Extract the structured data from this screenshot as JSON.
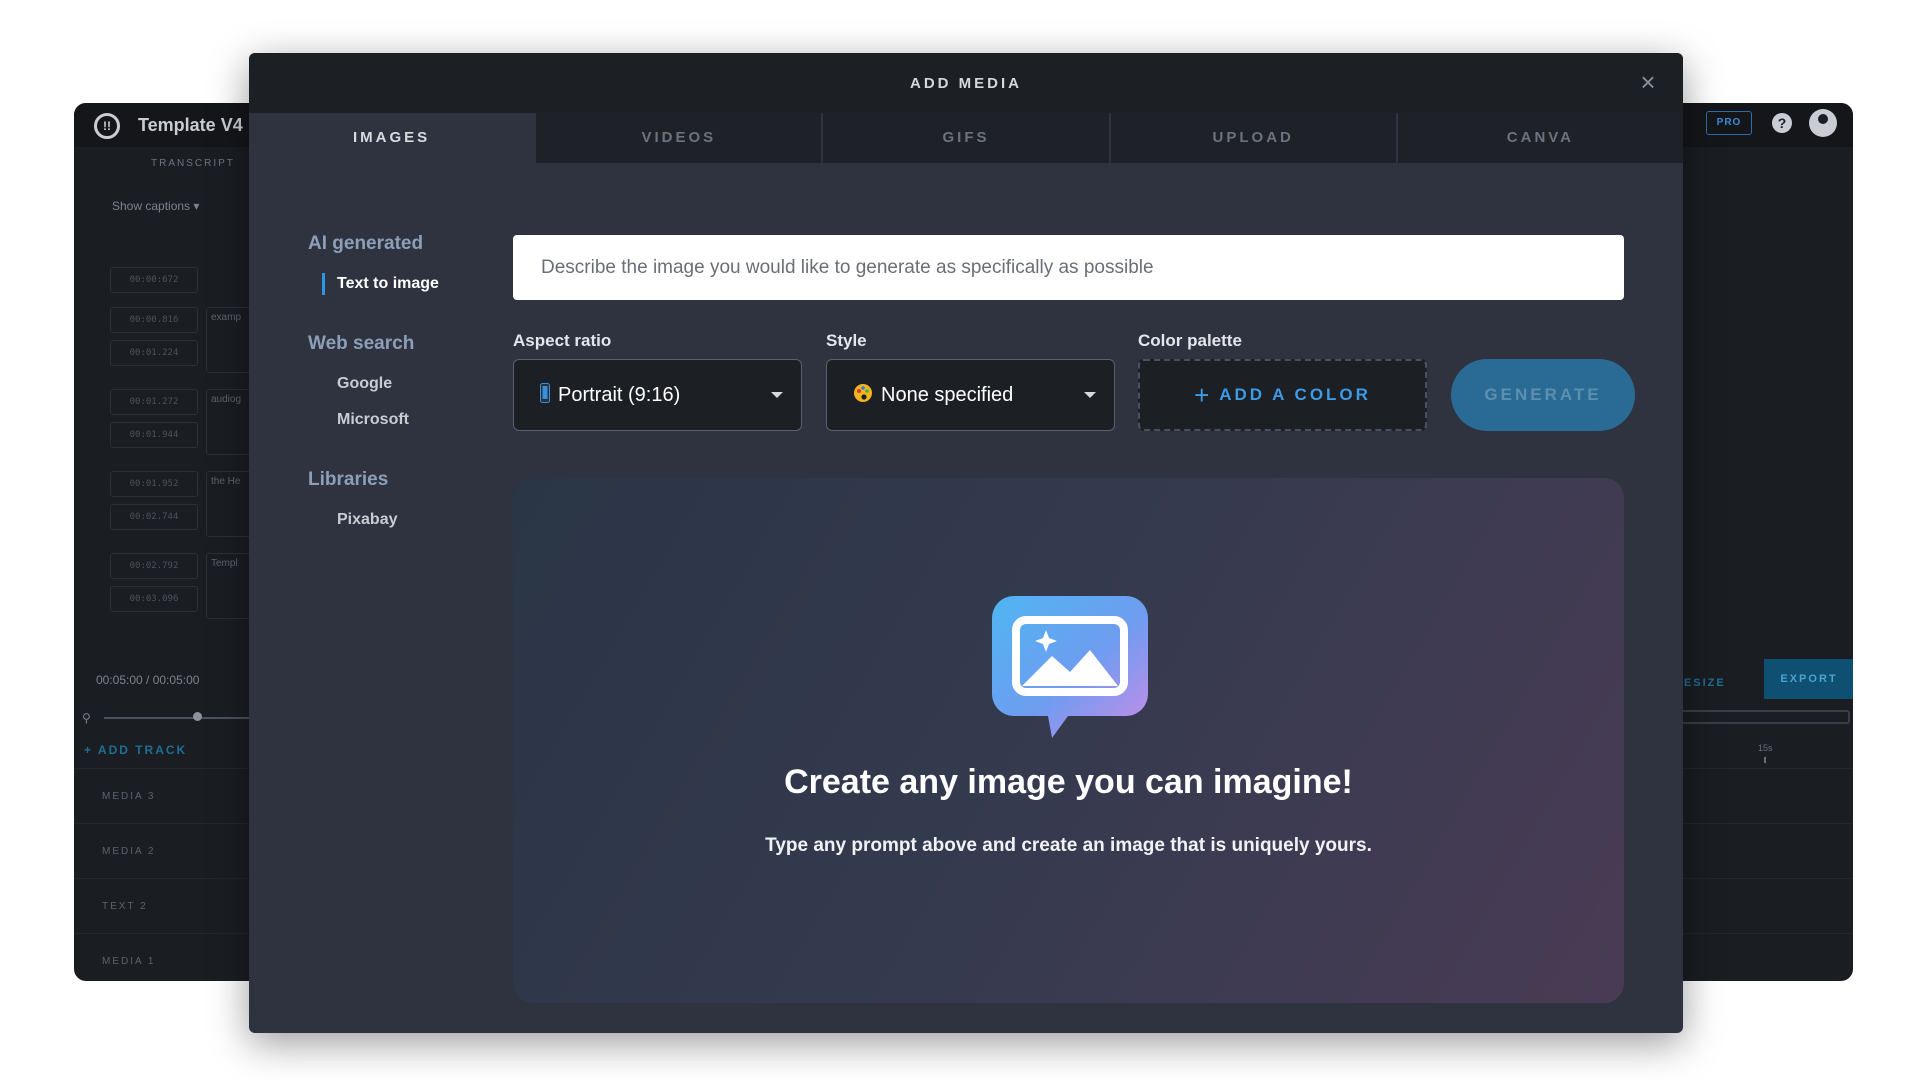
{
  "background_app": {
    "title": "Template V4",
    "panel_tab": "TRANSCRIPT",
    "captions_toggle": "Show captions  ▾",
    "caption_rows": [
      {
        "start": "00:00:672",
        "end": "",
        "text": ""
      },
      {
        "start": "00:00.816",
        "end": "00:01.224",
        "text": "examp"
      },
      {
        "start": "00:01.272",
        "end": "00:01.944",
        "text": "audiog"
      },
      {
        "start": "00:01.952",
        "end": "00:02.744",
        "text": "the He"
      },
      {
        "start": "00:02.792",
        "end": "00:03.096",
        "text": "Templ"
      }
    ],
    "time_display": "00:05:00 / 00:05:00",
    "add_track": "+ ADD TRACK",
    "tracks": [
      "MEDIA 3",
      "MEDIA 2",
      "TEXT 2",
      "MEDIA 1"
    ],
    "pro_badge": "PRO",
    "help_icon": "?",
    "resize_label": "RESIZE",
    "export_label": "EXPORT",
    "timeline_marker": "15s"
  },
  "modal": {
    "title": "ADD MEDIA",
    "close_icon": "×",
    "tabs": [
      {
        "label": "IMAGES",
        "active": true
      },
      {
        "label": "VIDEOS",
        "active": false
      },
      {
        "label": "GIFS",
        "active": false
      },
      {
        "label": "UPLOAD",
        "active": false
      },
      {
        "label": "CANVA",
        "active": false
      }
    ],
    "sidebar": {
      "ai_group": "AI generated",
      "ai_items": [
        "Text to image"
      ],
      "web_group": "Web search",
      "web_items": [
        "Google",
        "Microsoft"
      ],
      "lib_group": "Libraries",
      "lib_items": [
        "Pixabay"
      ]
    },
    "prompt": {
      "placeholder": "Describe the image you would like to generate as specifically as possible",
      "value": ""
    },
    "aspect_ratio": {
      "label": "Aspect ratio",
      "icon": "phone-icon",
      "value": "Portrait (9:16)"
    },
    "style": {
      "label": "Style",
      "icon": "palette-icon",
      "value": "None specified"
    },
    "color_palette": {
      "label": "Color palette",
      "button": "ADD A COLOR",
      "icon": "+"
    },
    "generate_label": "GENERATE",
    "hero": {
      "icon": "image-chat-bubble-icon",
      "title": "Create any image you can imagine!",
      "subtitle": "Type any prompt above and create an image that is uniquely yours."
    },
    "colors": {
      "accent": "#2f95e6",
      "modal_bg": "#2f3340",
      "header_bg": "#1c1f24",
      "generate_bg": "#2a6b96"
    }
  }
}
